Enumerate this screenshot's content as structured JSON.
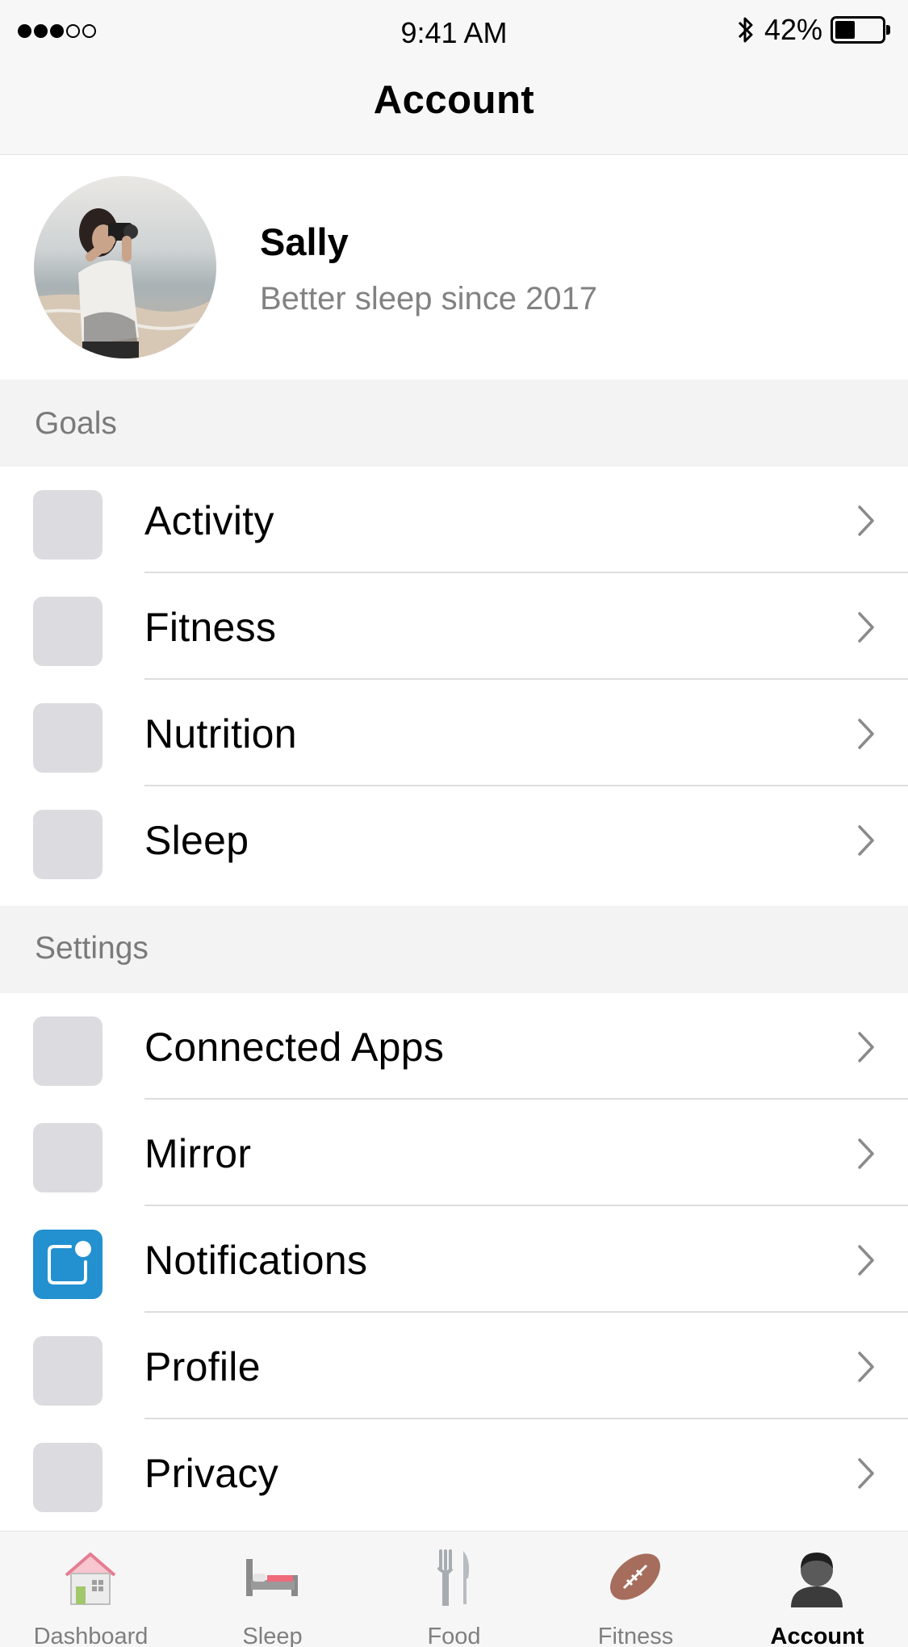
{
  "status_bar": {
    "time": "9:41 AM",
    "battery_text": "42%",
    "battery_level": 0.42,
    "signal_bars_filled": 3,
    "signal_bars_total": 5
  },
  "nav": {
    "title": "Account"
  },
  "profile": {
    "name": "Sally",
    "subtitle": "Better sleep since 2017"
  },
  "goals": {
    "header": "Goals",
    "items": [
      {
        "label": "Activity"
      },
      {
        "label": "Fitness"
      },
      {
        "label": "Nutrition"
      },
      {
        "label": "Sleep"
      }
    ]
  },
  "settings": {
    "header": "Settings",
    "items": [
      {
        "label": "Connected Apps"
      },
      {
        "label": "Mirror"
      },
      {
        "label": "Notifications",
        "icon": "notification-badge-icon",
        "icon_color": "#2390d0"
      },
      {
        "label": "Profile"
      },
      {
        "label": "Privacy"
      }
    ]
  },
  "tabbar": {
    "tabs": [
      {
        "label": "Dashboard",
        "icon": "house-icon"
      },
      {
        "label": "Sleep",
        "icon": "bed-icon"
      },
      {
        "label": "Food",
        "icon": "fork-knife-icon"
      },
      {
        "label": "Fitness",
        "icon": "football-icon"
      },
      {
        "label": "Account",
        "icon": "person-icon",
        "active": true
      }
    ]
  }
}
